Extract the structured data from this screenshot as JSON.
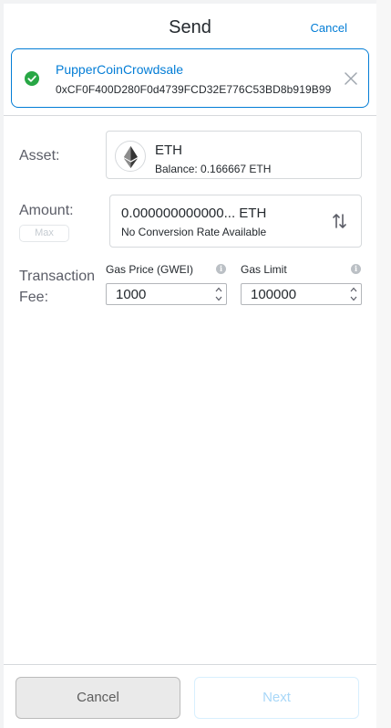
{
  "header": {
    "title": "Send",
    "cancel_label": "Cancel"
  },
  "contract": {
    "name": "PupperCoinCrowdsale",
    "address": "0xCF0F400D280F0d4739FCD32E776C53BD8b919B99"
  },
  "asset": {
    "label": "Asset:",
    "symbol": "ETH",
    "balance": "Balance: 0.166667 ETH"
  },
  "amount": {
    "label": "Amount:",
    "max_label": "Max",
    "value": "0.000000000000... ETH",
    "conversion": "No Conversion Rate Available"
  },
  "fee": {
    "label_line1": "Transaction",
    "label_line2": "Fee:",
    "gas_price_label": "Gas Price (GWEI)",
    "gas_price_value": "1000",
    "gas_limit_label": "Gas Limit",
    "gas_limit_value": "100000"
  },
  "footer": {
    "cancel_label": "Cancel",
    "next_label": "Next"
  },
  "colors": {
    "accent": "#037dd6",
    "success": "#28a745",
    "border": "#d6d9dc"
  },
  "icons": [
    "check-circle-icon",
    "close-icon",
    "ethereum-icon",
    "swap-arrows-icon",
    "info-icon",
    "spinner-up-icon",
    "spinner-down-icon"
  ]
}
